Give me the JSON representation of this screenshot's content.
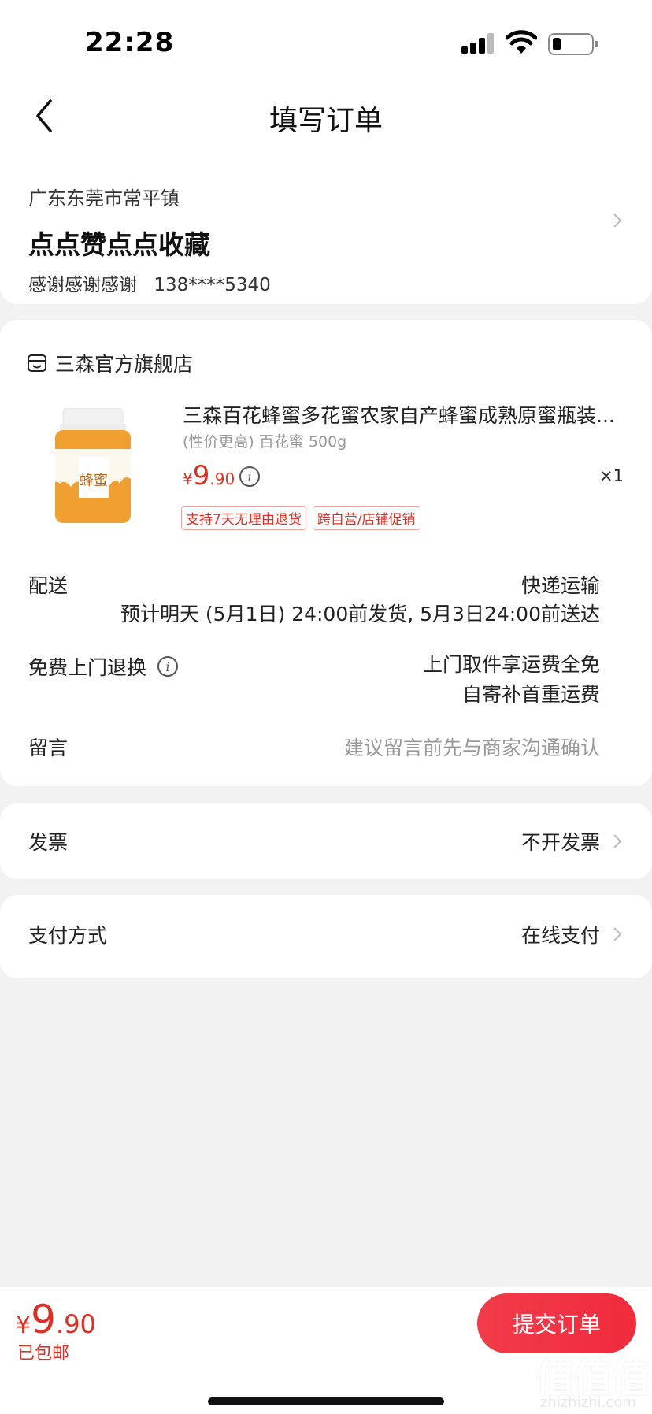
{
  "status_bar": {
    "time": "22:28"
  },
  "nav": {
    "title": "填写订单"
  },
  "address": {
    "region": "广东东莞市常平镇",
    "detail": "点点赞点点收藏",
    "name": "感谢感谢感谢",
    "phone": "138****5340"
  },
  "store": {
    "name": "三森官方旗舰店"
  },
  "product": {
    "title": "三森百花蜂蜜多花蜜农家自产蜂蜜成熟原蜜瓶装...",
    "spec": "(性价更高) 百花蜜 500g",
    "price_yen": "¥",
    "price_int": "9",
    "price_dec": ".90",
    "quantity": "×1",
    "tags": [
      "支持7天无理由退货",
      "跨自营/店铺促销"
    ],
    "image_label": "蜂蜜"
  },
  "delivery": {
    "label": "配送",
    "method": "快递运输",
    "estimate": "预计明天 (5月1日) 24:00前发货, 5月3日24:00前送达"
  },
  "return": {
    "label": "免费上门退换",
    "line1": "上门取件享运费全免",
    "line2": "自寄补首重运费"
  },
  "message": {
    "label": "留言",
    "placeholder": "建议留言前先与商家沟通确认"
  },
  "invoice": {
    "label": "发票",
    "value": "不开发票"
  },
  "payment": {
    "label": "支付方式",
    "value": "在线支付"
  },
  "bottom": {
    "yen": "¥",
    "price_int": "9",
    "price_dec": ".90",
    "shipping": "已包邮",
    "submit_label": "提交订单"
  },
  "watermark": {
    "mark": "值值值",
    "text": "zhizhizhi.com"
  },
  "colors": {
    "accent": "#e02e24",
    "button": "#f02b3c",
    "background": "#f2f2f2"
  }
}
